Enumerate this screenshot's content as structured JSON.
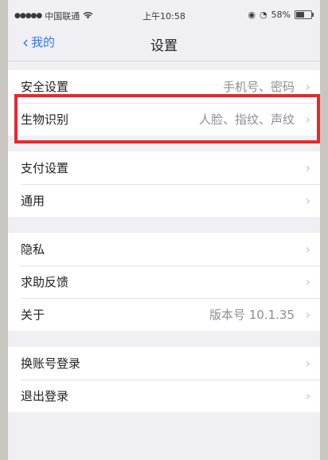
{
  "status": {
    "carrier": "中国联通",
    "time": "上午10:58",
    "battery": "58%",
    "battery_level": 0.58
  },
  "nav": {
    "back_label": "我的",
    "title": "设置"
  },
  "groups": [
    {
      "rows": [
        {
          "label": "安全设置",
          "value": "手机号、密码"
        },
        {
          "label": "生物识别",
          "value": "人脸、指纹、声纹"
        }
      ]
    },
    {
      "rows": [
        {
          "label": "支付设置",
          "value": ""
        },
        {
          "label": "通用",
          "value": ""
        }
      ]
    },
    {
      "rows": [
        {
          "label": "隐私",
          "value": ""
        },
        {
          "label": "求助反馈",
          "value": ""
        },
        {
          "label": "关于",
          "value": "版本号 10.1.35"
        }
      ]
    },
    {
      "rows": [
        {
          "label": "换账号登录",
          "value": ""
        },
        {
          "label": "退出登录",
          "value": ""
        }
      ]
    }
  ],
  "colors": {
    "accent": "#3478f6",
    "highlight": "#e8272d"
  }
}
